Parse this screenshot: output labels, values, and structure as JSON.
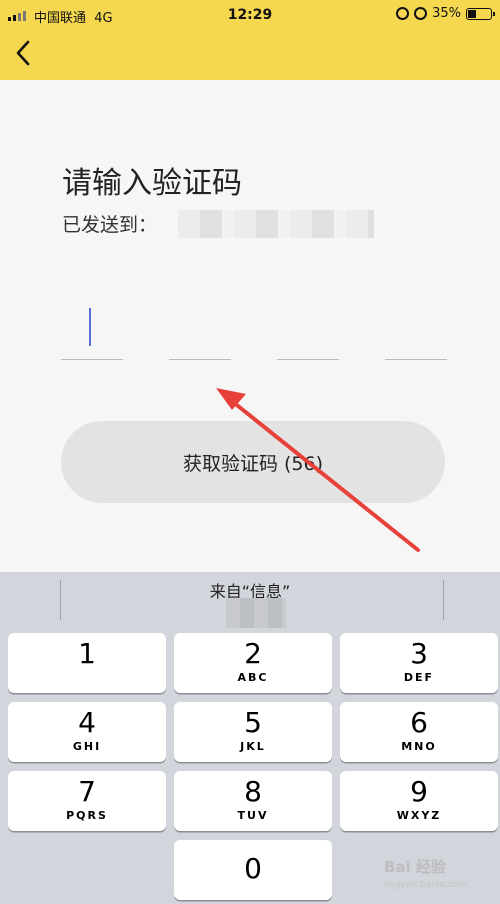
{
  "status_bar": {
    "carrier": "中国联通",
    "network": "4G",
    "time": "12:29",
    "battery": "35%"
  },
  "nav": {
    "back_icon": "chevron-left-icon"
  },
  "page": {
    "title": "请输入验证码",
    "sent_to_label": "已发送到：",
    "resend_button": "获取验证码 (56)"
  },
  "keyboard": {
    "quicktype_source": "来自“信息”",
    "keys": [
      {
        "num": "1",
        "letters": ""
      },
      {
        "num": "2",
        "letters": "ABC"
      },
      {
        "num": "3",
        "letters": "DEF"
      },
      {
        "num": "4",
        "letters": "GHI"
      },
      {
        "num": "5",
        "letters": "JKL"
      },
      {
        "num": "6",
        "letters": "MNO"
      },
      {
        "num": "7",
        "letters": "PQRS"
      },
      {
        "num": "8",
        "letters": "TUV"
      },
      {
        "num": "9",
        "letters": "WXYZ"
      },
      {
        "num": "0",
        "letters": ""
      }
    ]
  },
  "watermark": {
    "text": "Bai 经验",
    "url": "jingyan.baidu.com"
  },
  "colors": {
    "header": "#f5d84f",
    "annotation_arrow": "#e8413c",
    "cursor": "#5a6fd6"
  }
}
